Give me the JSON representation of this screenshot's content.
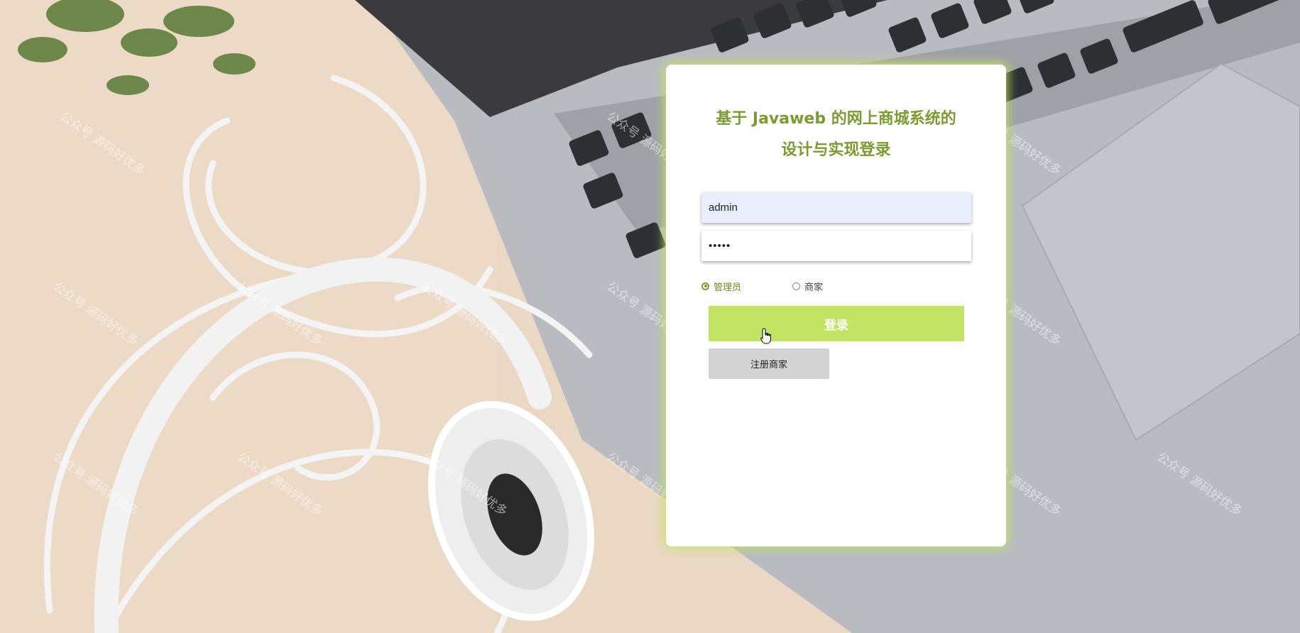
{
  "login": {
    "title_line1": "基于 Javaweb 的网上商城系统的",
    "title_line2": "设计与实现登录",
    "username_value": "admin",
    "password_value": "•••••",
    "roles": [
      {
        "label": "管理员",
        "checked": true
      },
      {
        "label": "商家",
        "checked": false
      }
    ],
    "login_button": "登录",
    "register_button": "注册商家"
  },
  "watermark": {
    "text": "公众号 源码好优多"
  },
  "colors": {
    "accent": "#7c9a34",
    "login_button": "#c2e363",
    "register_button": "#d3d3d3",
    "card_glow": "#bee65f"
  }
}
